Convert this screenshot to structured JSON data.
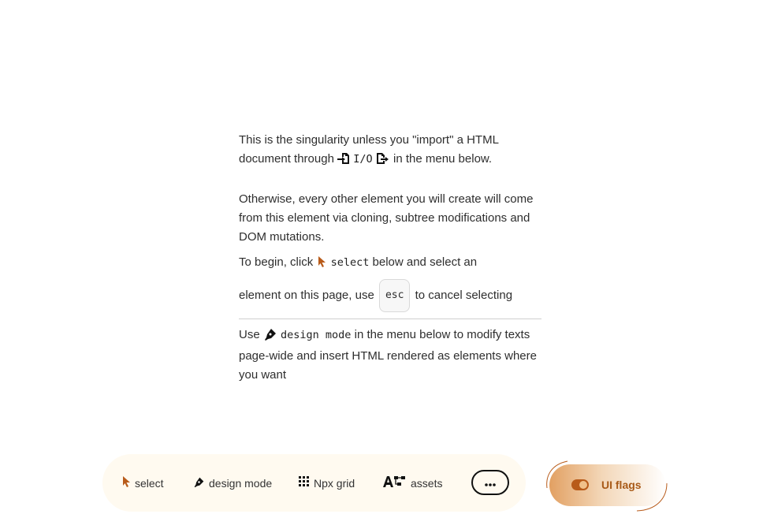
{
  "intro": {
    "p1_a": "This is the singularity unless you \"import\" a HTML document through",
    "io_label": "I/O",
    "p1_b": "in the menu below.",
    "p2": "Otherwise, every other element you will create will come from this element via cloning, subtree modifications and DOM mutations.",
    "begin_a": "To begin, click",
    "select_label": "select",
    "begin_b": "below and select an",
    "elem_a": "element on this page, use",
    "esc_key": "esc",
    "elem_b": "to cancel selecting",
    "use_a": "Use",
    "design_label": "design mode",
    "use_b": "in the menu below to modify texts page-wide and insert HTML rendered as elements where you want"
  },
  "toolbar": {
    "select_label": "select",
    "design_label": "design mode",
    "grid_label": "Npx grid",
    "assets_label": "assets",
    "more_label": "•••"
  },
  "flags": {
    "label": "UI flags"
  },
  "colors": {
    "accent": "#b85b1a",
    "toolbar_bg": "#fffaf0"
  },
  "icons": [
    "import-icon",
    "export-icon",
    "cursor-icon",
    "pen-icon",
    "grid-icon",
    "assets-icon",
    "more-icon",
    "toggle-icon"
  ]
}
